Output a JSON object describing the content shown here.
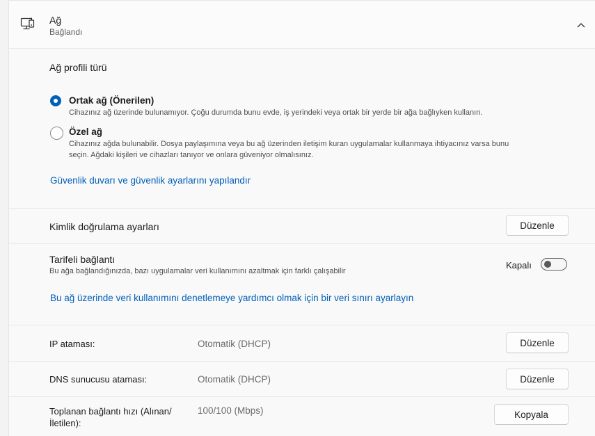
{
  "header": {
    "title": "Ağ",
    "subtitle": "Bağlandı",
    "icon": "network-monitor-icon",
    "collapse_icon": "chevron-up-icon"
  },
  "profile": {
    "heading": "Ağ profili türü",
    "options": [
      {
        "label": "Ortak ağ (Önerilen)",
        "description": "Cihazınız ağ üzerinde bulunamıyor. Çoğu durumda bunu evde, iş yerindeki veya ortak bir yerde bir ağa bağlıyken kullanın.",
        "selected": true
      },
      {
        "label": "Özel ağ",
        "description_line1": "Cihazınız ağda bulunabilir. Dosya paylaşımına veya bu ağ üzerinden iletişim kuran uygulamalar kullanmaya ihtiyacınız varsa bunu",
        "description_line2": "seçin. Ağdaki kişileri ve cihazları tanıyor ve onlara güveniyor olmalısınız.",
        "selected": false
      }
    ],
    "firewall_link": "Güvenlik duvarı ve güvenlik ayarlarını yapılandır"
  },
  "auth": {
    "label": "Kimlik doğrulama ayarları",
    "button": "Düzenle"
  },
  "metered": {
    "label": "Tarifeli bağlantı",
    "description": "Bu ağa bağlandığınızda, bazı uygulamalar veri kullanımını azaltmak için farklı çalışabilir",
    "state_label": "Kapalı",
    "on": false,
    "data_limit_link": "Bu ağ üzerinde veri kullanımını denetlemeye yardımcı olmak için bir veri sınırı ayarlayın"
  },
  "ip": {
    "label": "IP ataması:",
    "value": "Otomatik (DHCP)",
    "button": "Düzenle"
  },
  "dns": {
    "label": "DNS sunucusu ataması:",
    "value": "Otomatik (DHCP)",
    "button": "Düzenle"
  },
  "speed": {
    "label_line1": "Toplanan bağlantı hızı (Alınan/",
    "label_line2": "İletilen):",
    "value": "100/100 (Mbps)",
    "button": "Kopyala"
  },
  "colors": {
    "accent": "#005fb8",
    "background": "#f3f3f3",
    "card": "#fbfbfb"
  }
}
